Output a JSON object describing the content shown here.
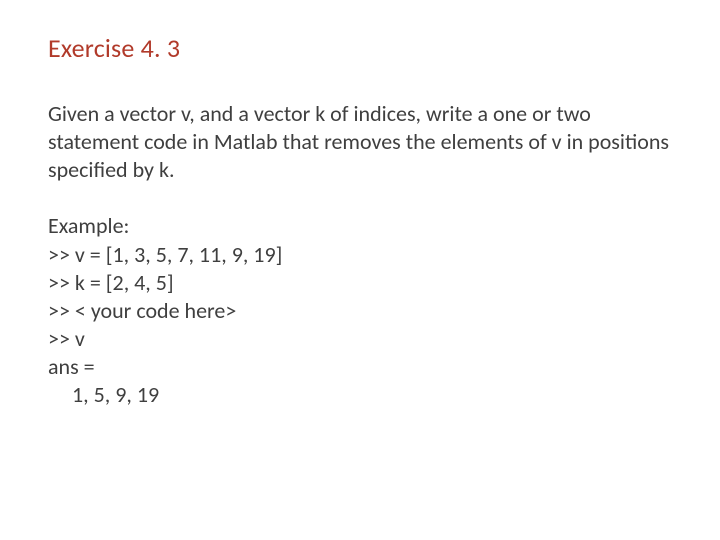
{
  "title": "Exercise 4. 3",
  "description": "Given a vector v, and a vector k of indices, write a one or two statement code in Matlab that removes the elements of v in positions specified by k.",
  "example_label": "Example:",
  "line_v": ">> v = [1, 3, 5, 7, 11, 9, 19]",
  "line_k": ">> k = [2, 4, 5]",
  "line_code": ">>  < your code here>",
  "line_query": ">> v",
  "line_ans": "ans =",
  "line_result": "1, 5, 9, 19"
}
